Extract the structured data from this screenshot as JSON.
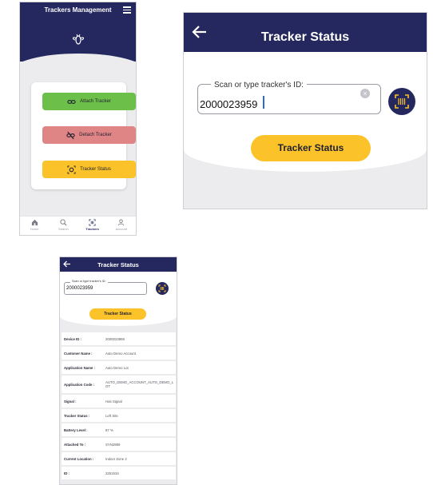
{
  "colors": {
    "navy": "#25285e",
    "yellow": "#fbc22a",
    "green": "#6cc04a",
    "red": "#e08585",
    "background": "#ececee"
  },
  "panel1": {
    "header_title": "Trackers Management",
    "menu_icon": "hamburger-icon",
    "logo_icon": "bee-logo-icon",
    "buttons": [
      {
        "label": "Attach Tracker",
        "icon": "link-icon",
        "color": "#6cc04a"
      },
      {
        "label": "Detach Tracker",
        "icon": "unlink-icon",
        "color": "#e08585"
      },
      {
        "label": "Tracker Status",
        "icon": "crosshair-icon",
        "color": "#fbc22a"
      }
    ],
    "tabs": [
      {
        "label": "Home",
        "icon": "home-icon"
      },
      {
        "label": "Search",
        "icon": "search-icon"
      },
      {
        "label": "Trackers",
        "icon": "barcode-icon",
        "active": true
      },
      {
        "label": "Account",
        "icon": "user-icon"
      }
    ]
  },
  "panel2": {
    "title": "Tracker Status",
    "field_label": "Scan or type tracker's ID:",
    "field_value": "2000023959",
    "button_label": "Tracker Status"
  },
  "panel3": {
    "title": "Tracker Status",
    "field_label": "Scan or type tracker's ID:",
    "field_value": "2000023959",
    "button_label": "Tracker Status",
    "rows": [
      {
        "key": "Device ID :",
        "value": "2000023959"
      },
      {
        "key": "Customer Name :",
        "value": "Auto Demo Account"
      },
      {
        "key": "Application Name :",
        "value": "Auto Demo Lot"
      },
      {
        "key": "Application Code :",
        "value": "AUTO_DEMO_ACCOUNT_AUTO_DEMO_LOT"
      },
      {
        "key": "Signal :",
        "value": "Has Signal"
      },
      {
        "key": "Tracker Status :",
        "value": "Left Site"
      },
      {
        "key": "Battery Level :",
        "value": "87 %"
      },
      {
        "key": "Attached To :",
        "value": "SYN2959"
      },
      {
        "key": "Current Location :",
        "value": "Indoor Zone 2"
      },
      {
        "key": "ID :",
        "value": "2251534"
      }
    ]
  }
}
